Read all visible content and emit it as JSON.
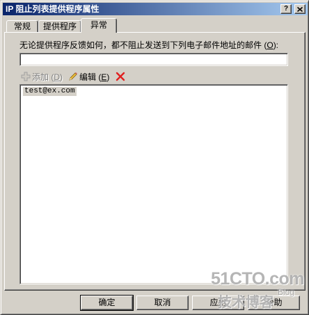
{
  "title_bar": {
    "title": "IP 阻止列表提供程序属性",
    "help_glyph": "?",
    "icons": {
      "help": "help-icon",
      "close": "close-icon"
    }
  },
  "tabs": [
    {
      "label": "常规",
      "selected": false
    },
    {
      "label": "提供程序",
      "selected": false
    },
    {
      "label": "异常",
      "selected": true
    }
  ],
  "exceptions": {
    "label": {
      "text": "无论提供程序反馈如何，都不阻止发送到下列电子邮件地址的邮件 (",
      "access_key": "O",
      "suffix": "):"
    },
    "address_input": {
      "value": ""
    },
    "toolbar": {
      "add": {
        "text": "添加 (",
        "access_key": "D",
        "suffix": ")",
        "enabled": false,
        "icon": "plus-icon"
      },
      "edit": {
        "text": "编辑 (",
        "access_key": "E",
        "suffix": ")",
        "enabled": true,
        "icon": "pencil-icon"
      },
      "delete": {
        "enabled": true,
        "icon": "delete-icon"
      }
    },
    "address_list": {
      "items": [
        "test@ex.com"
      ],
      "selected_index": 0
    }
  },
  "buttons": {
    "ok": "确定",
    "cancel": "取消",
    "apply": "应用",
    "help": "帮助"
  },
  "watermark": {
    "site": "51CTO.com",
    "blog": "Blog",
    "caption": "技术博客"
  },
  "colors": {
    "face": "#D4D0C8",
    "shadow": "#808080",
    "dark": "#404040",
    "light": "#FFFFFF",
    "title-start": "#0A246A",
    "title-end": "#A6CAF0",
    "disabled": "#808080",
    "selection": "#D4D0C8",
    "delete": "#E02020"
  }
}
